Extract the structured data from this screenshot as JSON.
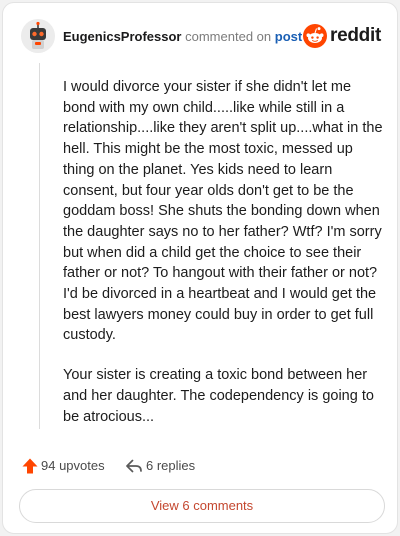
{
  "header": {
    "username": "EugenicsProfessor",
    "verb": "commented on",
    "link_text": "post",
    "brand_word": "reddit",
    "avatar_icon": "robot-avatar-icon",
    "brand_icon": "reddit-alien-icon"
  },
  "comment": {
    "paragraphs": [
      "I would divorce your sister if she didn't let me bond with my own child.....like while still in a relationship....like they aren't split up....what in the hell. This might be the most toxic, messed up thing on the planet. Yes kids need to learn consent, but four year olds don't get to be the goddam boss! She shuts the bonding down when the daughter says no to her father? Wtf? I'm sorry but when did a child get the choice to see their father or not? To hangout with their father or not? I'd be divorced in a heartbeat and I would get the best lawyers money could buy in order to get full custody.",
      "Your sister is creating a toxic bond between her and her daughter. The codependency is going to be atrocious..."
    ]
  },
  "actions": {
    "upvotes_label": "94 upvotes",
    "replies_label": "6 replies",
    "upvote_icon": "upvote-arrow-icon",
    "reply_icon": "reply-arrow-icon"
  },
  "footer": {
    "view_comments_label": "View 6 comments"
  },
  "colors": {
    "brand_orange": "#ff4500",
    "link_blue": "#1a5fb4",
    "upvote_orange": "#ff4500",
    "view_button_text": "#c4472f"
  }
}
